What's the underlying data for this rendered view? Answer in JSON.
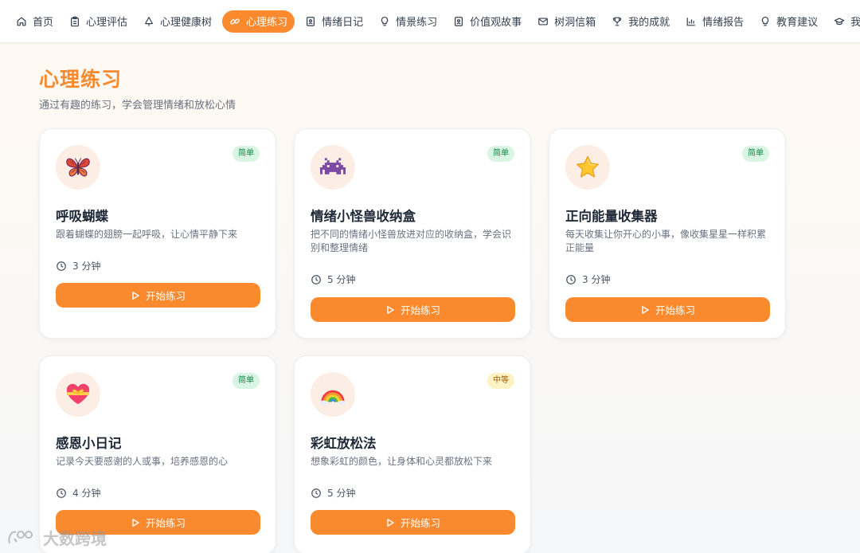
{
  "nav": {
    "items": [
      {
        "label": "首页",
        "icon": "home-icon"
      },
      {
        "label": "心理评估",
        "icon": "clipboard-icon"
      },
      {
        "label": "心理健康树",
        "icon": "tree-icon"
      },
      {
        "label": "心理练习",
        "icon": "link-icon",
        "active": true
      },
      {
        "label": "情绪日记",
        "icon": "journal-icon"
      },
      {
        "label": "情景练习",
        "icon": "lightbulb-icon"
      },
      {
        "label": "价值观故事",
        "icon": "book-icon"
      },
      {
        "label": "树洞信箱",
        "icon": "mail-icon"
      },
      {
        "label": "我的成就",
        "icon": "trophy-icon"
      },
      {
        "label": "情绪报告",
        "icon": "bar-chart-icon"
      },
      {
        "label": "教育建议",
        "icon": "lightbulb-icon"
      },
      {
        "label": "我的学生",
        "icon": "graduation-cap-icon"
      }
    ],
    "active_color": "#fb8a2e"
  },
  "header": {
    "title": "心理练习",
    "subtitle": "通过有趣的练习，学会管理情绪和放松心情",
    "title_color": "#f7892e"
  },
  "cards": [
    {
      "title": "呼吸蝴蝶",
      "desc": "跟着蝴蝶的翅膀一起呼吸，让心情平静下来",
      "duration": "3 分钟",
      "badge": "简单",
      "level": "easy",
      "icon": "butterfly-icon",
      "button": "开始练习"
    },
    {
      "title": "情绪小怪兽收纳盒",
      "desc": "把不同的情绪小怪兽放进对应的收纳盒，学会识别和整理情绪",
      "duration": "5 分钟",
      "badge": "简单",
      "level": "easy",
      "icon": "space-invader-icon",
      "button": "开始练习"
    },
    {
      "title": "正向能量收集器",
      "desc": "每天收集让你开心的小事，像收集星星一样积累正能量",
      "duration": "3 分钟",
      "badge": "简单",
      "level": "easy",
      "icon": "star-icon",
      "button": "开始练习"
    },
    {
      "title": "感恩小日记",
      "desc": "记录今天要感谢的人或事，培养感恩的心",
      "duration": "4 分钟",
      "badge": "简单",
      "level": "easy",
      "icon": "gift-heart-icon",
      "button": "开始练习"
    },
    {
      "title": "彩虹放松法",
      "desc": "想象彩虹的颜色，让身体和心灵都放松下来",
      "duration": "5 分钟",
      "badge": "中等",
      "level": "medium",
      "icon": "rainbow-icon",
      "button": "开始练习"
    }
  ],
  "watermark": {
    "text": "大数跨境"
  },
  "colors": {
    "accent": "#fb8a2e",
    "easy_bg": "#d9f5e3",
    "easy_fg": "#16864a",
    "medium_bg": "#fdf3c4",
    "medium_fg": "#a15c06"
  }
}
